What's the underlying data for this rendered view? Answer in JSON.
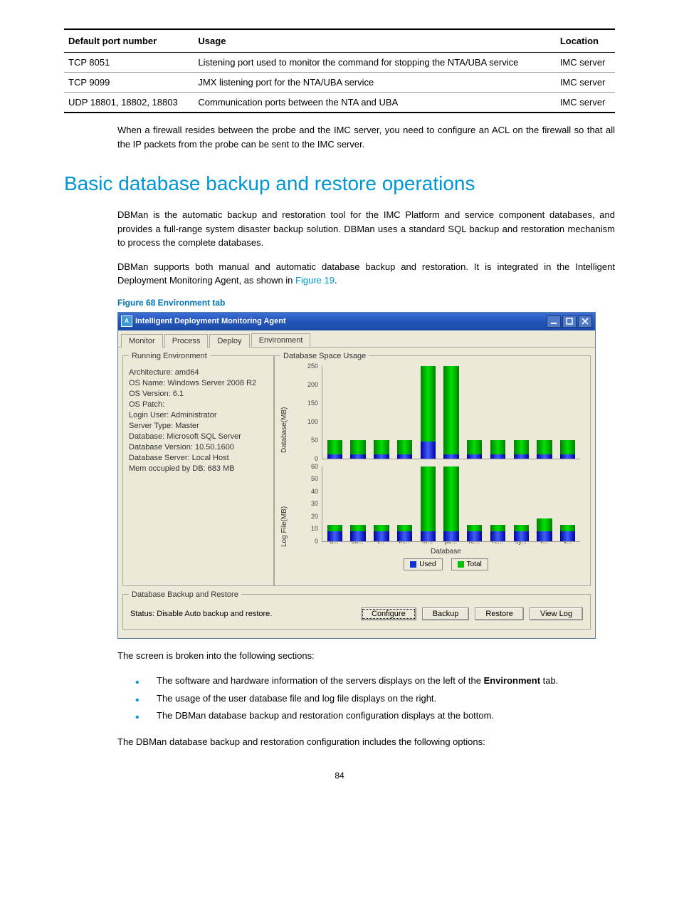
{
  "port_table": {
    "headers": [
      "Default port number",
      "Usage",
      "Location"
    ],
    "rows": [
      {
        "port": "TCP 8051",
        "usage": "Listening port used to monitor the command for stopping the NTA/UBA service",
        "loc": "IMC server"
      },
      {
        "port": "TCP 9099",
        "usage": "JMX listening port for the NTA/UBA service",
        "loc": "IMC server"
      },
      {
        "port": "UDP 18801, 18802, 18803",
        "usage": "Communication ports between the NTA and UBA",
        "loc": "IMC server"
      }
    ]
  },
  "para1": "When a firewall resides between the probe and the IMC server, you need to configure an ACL on the firewall so that all the IP packets from the probe can be sent to the IMC server.",
  "h1": "Basic database backup and restore operations",
  "para2": "DBMan is the automatic backup and restoration tool for the IMC Platform and service component databases, and provides a full-range system disaster backup solution. DBMan uses a standard SQL backup and restoration mechanism to process the complete databases.",
  "para3_a": "DBMan supports both manual and automatic database backup and restoration. It is integrated in the Intelligent Deployment Monitoring Agent, as shown in ",
  "para3_link": "Figure 19",
  "para3_b": ".",
  "fig_caption": "Figure 68 Environment tab",
  "app": {
    "title": "Intelligent Deployment Monitoring Agent",
    "tabs": [
      "Monitor",
      "Process",
      "Deploy",
      "Environment"
    ],
    "active_tab": 3,
    "group_running": "Running Environment",
    "group_dbusage": "Database Space Usage",
    "group_backup": "Database Backup and Restore",
    "env_lines": [
      "Architecture: amd64",
      "OS Name: Windows Server 2008 R2",
      "OS Version: 6.1",
      "OS Patch:",
      "Login User: Administrator",
      "Server Type: Master",
      "Database: Microsoft SQL Server",
      "Database Version: 10.50.1600",
      "Database Server: Local Host",
      "Mem occupied by DB: 683 MB"
    ],
    "status": "Status: Disable Auto backup and restore.",
    "buttons": {
      "configure": "Configure",
      "backup": "Backup",
      "restore": "Restore",
      "viewlog": "View Log"
    }
  },
  "chart_data": {
    "type": "bar",
    "title": "Database Space Usage",
    "xlabel": "Database",
    "categories": [
      "a...",
      "co...",
      "i...",
      "in...",
      "m...",
      "pe...",
      "re...",
      "re...",
      "sy...",
      "v...",
      "v..."
    ],
    "panels": [
      {
        "ylabel": "Database(MB)",
        "ylim": [
          0,
          250
        ],
        "series": [
          {
            "name": "Total",
            "values": [
              50,
              50,
              50,
              50,
              250,
              250,
              50,
              50,
              50,
              50,
              50
            ]
          },
          {
            "name": "Used",
            "values": [
              10,
              10,
              10,
              10,
              45,
              10,
              10,
              10,
              10,
              10,
              10
            ]
          }
        ]
      },
      {
        "ylabel": "Log File(MB)",
        "ylim": [
          0,
          60
        ],
        "series": [
          {
            "name": "Total",
            "values": [
              13,
              13,
              13,
              13,
              62,
              62,
              13,
              13,
              13,
              18,
              13
            ]
          },
          {
            "name": "Used",
            "values": [
              8,
              8,
              8,
              8,
              8,
              8,
              8,
              8,
              8,
              8,
              8
            ]
          }
        ]
      }
    ],
    "legend": [
      "Used",
      "Total"
    ]
  },
  "para4": "The screen is broken into the following sections:",
  "bullets": [
    {
      "pre": "The software and hardware information of the servers displays on the left of the ",
      "bold": "Environment",
      "post": " tab."
    },
    {
      "pre": "The usage of the user database file and log file displays on the right.",
      "bold": "",
      "post": ""
    },
    {
      "pre": "The DBMan database backup and restoration configuration displays at the bottom.",
      "bold": "",
      "post": ""
    }
  ],
  "para5": "The DBMan database backup and restoration configuration includes the following options:",
  "pagenum": "84"
}
